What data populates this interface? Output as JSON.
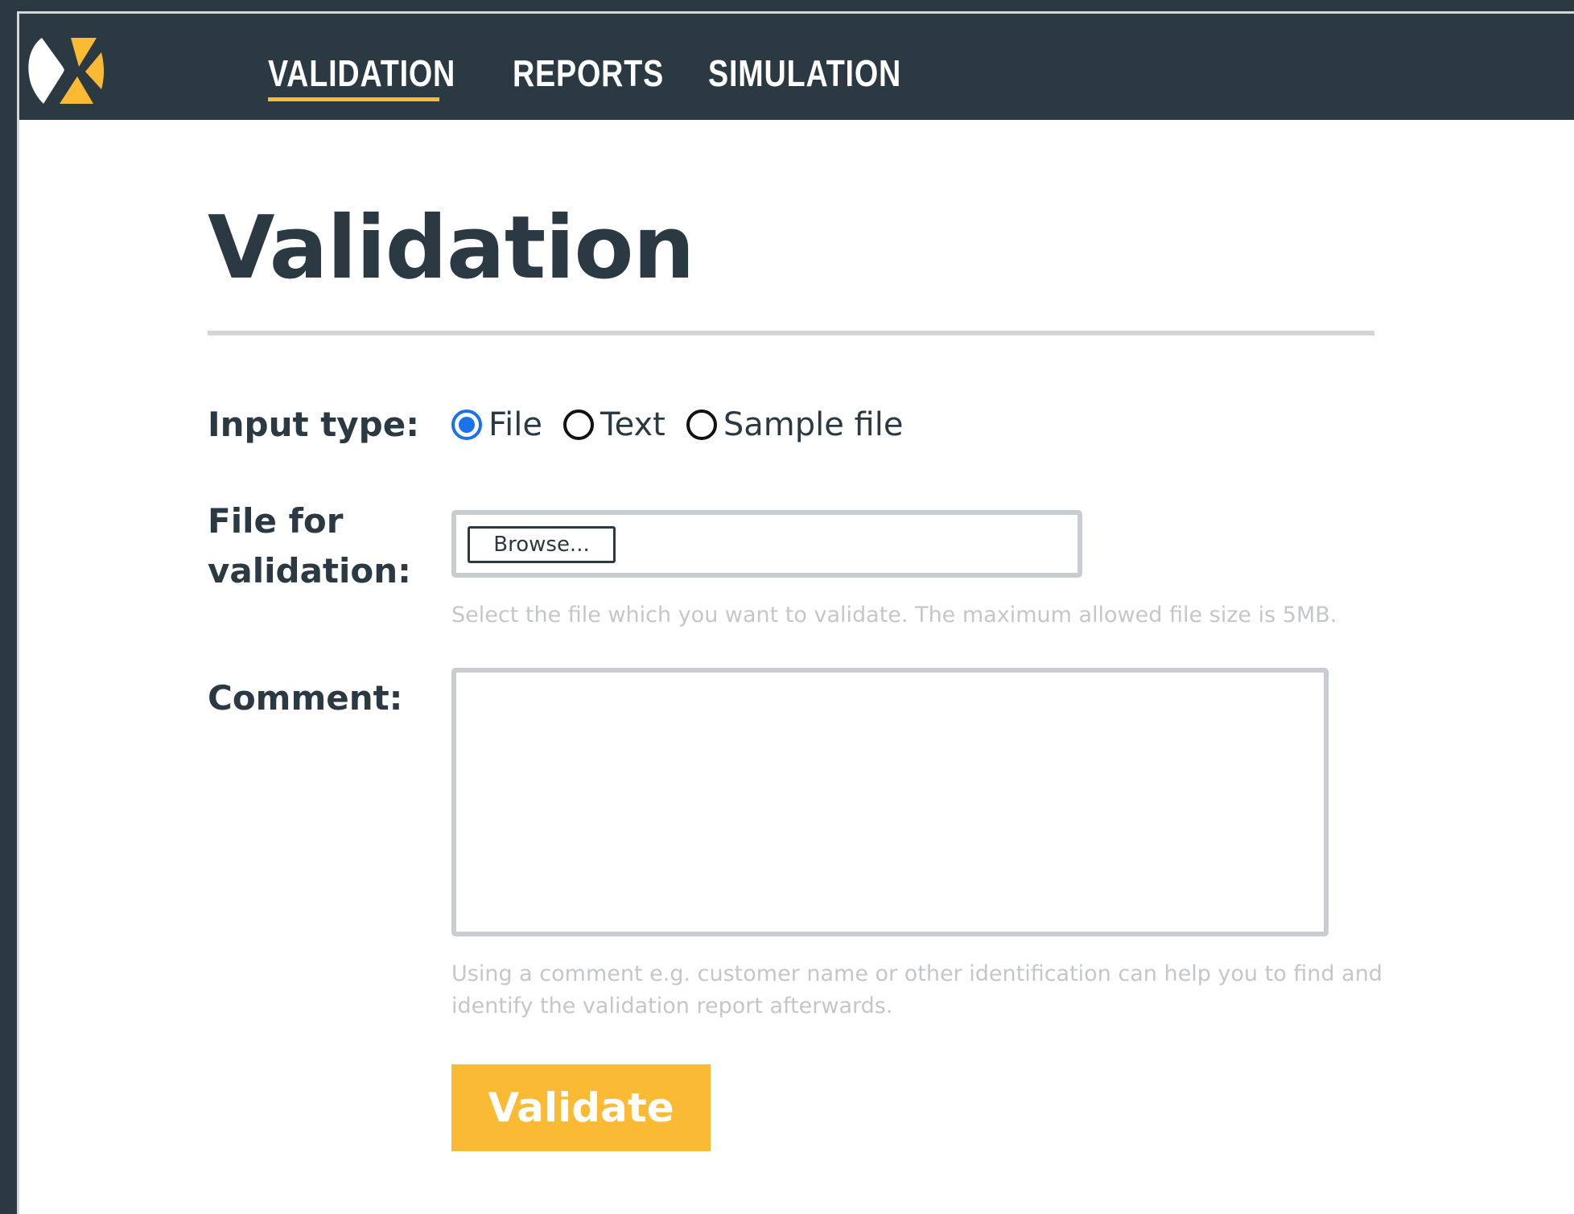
{
  "nav": {
    "items": [
      {
        "label": "VALIDATION",
        "active": true
      },
      {
        "label": "REPORTS",
        "active": false
      },
      {
        "label": "SIMULATION",
        "active": false
      }
    ],
    "accent_color": "#fbba33",
    "background_color": "#2b3a42"
  },
  "logo": {
    "icon": "x-logo-icon"
  },
  "page": {
    "title": "Validation"
  },
  "form": {
    "input_type": {
      "label": "Input type:",
      "options": [
        "File",
        "Text",
        "Sample file"
      ],
      "selected": "File"
    },
    "file": {
      "label_line1": "File for",
      "label_line2": "validation:",
      "browse_label": "Browse...",
      "help": "Select the file which you want to validate. The maximum allowed file size is 5MB."
    },
    "comment": {
      "label": "Comment:",
      "value": "",
      "help_line1": "Using a comment e.g. customer name or other identification can help you to find and",
      "help_line2": "identify the validation report afterwards."
    },
    "submit_label": "Validate",
    "radio_checked_color": "#1a73e8"
  }
}
